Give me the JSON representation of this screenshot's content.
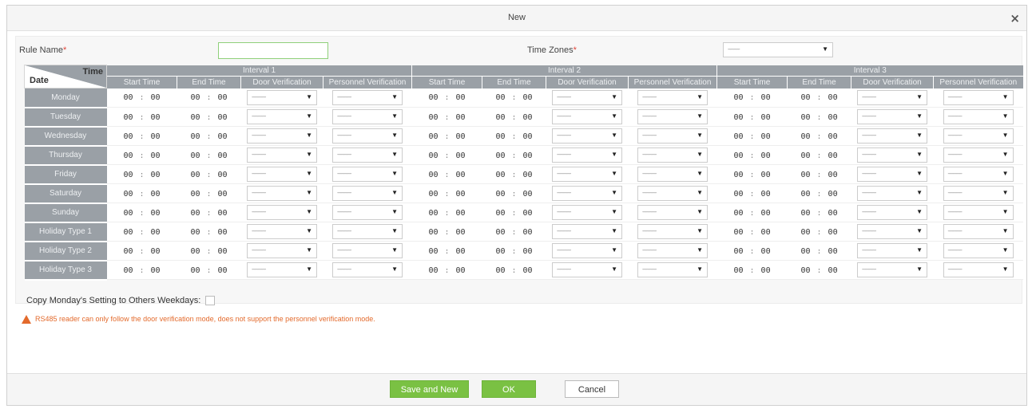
{
  "dialog": {
    "title": "New",
    "close_glyph": "×"
  },
  "form": {
    "rule_name_label": "Rule Name",
    "rule_name_value": "",
    "time_zones_label": "Time Zones",
    "time_zones_value": "-----------",
    "required_mark": "*"
  },
  "grid": {
    "corner_top": "Time",
    "corner_bottom": "Date",
    "intervals": [
      "Interval 1",
      "Interval 2",
      "Interval 3"
    ],
    "columns": [
      "Start Time",
      "End Time",
      "Door Verification",
      "Personnel Verification"
    ],
    "days": [
      "Monday",
      "Tuesday",
      "Wednesday",
      "Thursday",
      "Friday",
      "Saturday",
      "Sunday",
      "Holiday Type 1",
      "Holiday Type 2",
      "Holiday Type 3"
    ],
    "time_hour": "00",
    "time_minute": "00",
    "select_placeholder": "-------------"
  },
  "copy_label": "Copy Monday's Setting to Others Weekdays:",
  "warning": "RS485 reader can only follow the door verification mode, does not support the personnel verification mode.",
  "buttons": {
    "save_and_new": "Save and New",
    "ok": "OK",
    "cancel": "Cancel"
  },
  "colors": {
    "header_gray": "#9aa0a6",
    "accent_green": "#7ac143",
    "warning_orange": "#e36a2c",
    "required_red": "#e0453a"
  },
  "icons": {
    "close": "close-icon",
    "dropdown": "chevron-down-icon",
    "warning": "warning-icon"
  }
}
